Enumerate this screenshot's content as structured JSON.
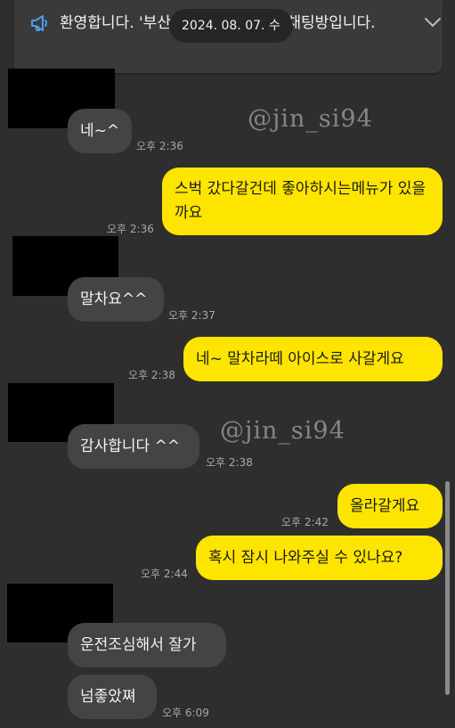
{
  "notice": {
    "text": "환영합니다. '부산 정지역 예약' 오픈채팅방입니다.",
    "icon": "megaphone-icon",
    "expand_icon": "chevron-down-icon"
  },
  "date_divider": "2024. 08. 07. 수",
  "watermarks": [
    "@jin_si94",
    "@jin_si94"
  ],
  "messages": [
    {
      "dir": "in",
      "text": "네~^",
      "time": "오후 2:36"
    },
    {
      "dir": "out",
      "text": "스벅 갔다갈건데 좋아하시는메뉴가 있을까요",
      "time": "오후 2:36"
    },
    {
      "dir": "in",
      "text": "말차요^^",
      "time": "오후 2:37"
    },
    {
      "dir": "out",
      "text": "네~ 말차라떼 아이스로 사갈게요",
      "time": "오후 2:38"
    },
    {
      "dir": "in",
      "text": "감사합니다 ^^",
      "time": "오후 2:38"
    },
    {
      "dir": "out",
      "text": "올라갈게요",
      "time": "오후 2:42"
    },
    {
      "dir": "out",
      "text": "혹시 잠시 나와주실 수 있나요?",
      "time": "오후 2:44"
    },
    {
      "dir": "in",
      "text": "운전조심해서 잘가",
      "time": ""
    },
    {
      "dir": "in",
      "text": "넘좋았쪄",
      "time": "오후 6:09"
    }
  ],
  "colors": {
    "background": "#2e2e2e",
    "incoming_bubble": "#444444",
    "outgoing_bubble": "#fee500",
    "time": "#a8a8a8"
  }
}
